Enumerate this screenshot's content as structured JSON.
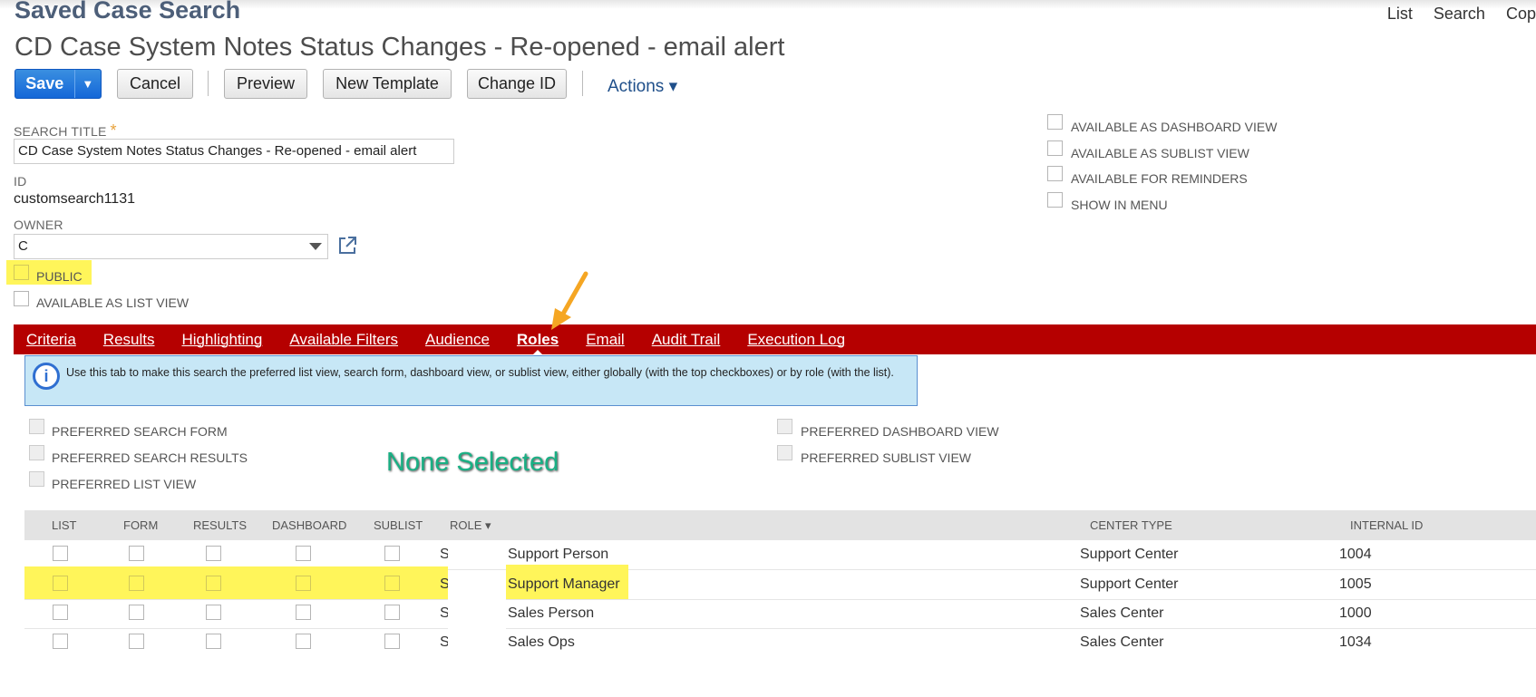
{
  "header": {
    "page_heading": "Saved Case Search",
    "top_links": [
      "List",
      "Search",
      "Cop"
    ],
    "record_title": "CD Case System Notes Status Changes - Re-opened - email alert"
  },
  "toolbar": {
    "save_label": "Save",
    "save_dropdown": "▼",
    "cancel_label": "Cancel",
    "preview_label": "Preview",
    "new_template_label": "New Template",
    "change_id_label": "Change ID",
    "actions_label": "Actions ▾"
  },
  "form": {
    "search_title_label": "SEARCH TITLE",
    "required_mark": "*",
    "search_title_value": "CD Case System Notes Status Changes - Re-opened - email alert",
    "id_label": "ID",
    "id_value": "customsearch1131",
    "owner_label": "OWNER",
    "owner_value": "C",
    "public_label": "PUBLIC",
    "available_as_list_view_label": "AVAILABLE AS LIST VIEW",
    "right_options": [
      "AVAILABLE AS DASHBOARD VIEW",
      "AVAILABLE AS SUBLIST VIEW",
      "AVAILABLE FOR REMINDERS",
      "SHOW IN MENU"
    ]
  },
  "tabs": [
    "Criteria",
    "Results",
    "Highlighting",
    "Available Filters",
    "Audience",
    "Roles",
    "Email",
    "Audit Trail",
    "Execution Log"
  ],
  "active_tab": "Roles",
  "info": {
    "icon": "info-icon",
    "text": "Use this tab to make this search the preferred list view, search form, dashboard view, or sublist view, either globally (with the top checkboxes) or by role (with the list)."
  },
  "preferences": {
    "left": [
      "PREFERRED SEARCH FORM",
      "PREFERRED SEARCH RESULTS",
      "PREFERRED LIST VIEW"
    ],
    "right": [
      "PREFERRED DASHBOARD VIEW",
      "PREFERRED SUBLIST VIEW"
    ]
  },
  "annotation": {
    "none_selected": "None Selected",
    "arrow_color": "#f5a623",
    "highlight_color": "#fff55a"
  },
  "grid": {
    "columns": [
      "LIST",
      "FORM",
      "RESULTS",
      "DASHBOARD",
      "SUBLIST",
      "ROLE ▾",
      "CENTER TYPE",
      "INTERNAL ID"
    ],
    "rows": [
      {
        "role_prefix": "S",
        "role": "Support Person",
        "center_type": "Support Center",
        "internal_id": "1004"
      },
      {
        "role_prefix": "S",
        "role": "Support Manager",
        "center_type": "Support Center",
        "internal_id": "1005"
      },
      {
        "role_prefix": "S",
        "role": "Sales Person",
        "center_type": "Sales Center",
        "internal_id": "1000"
      },
      {
        "role_prefix": "S",
        "role": "Sales Ops",
        "center_type": "Sales Center",
        "internal_id": "1034"
      }
    ]
  },
  "colors": {
    "tab_bar": "#b50000",
    "save_button": "#1467d8",
    "heading": "#4d5f79",
    "info_bg": "#c7e7f6"
  }
}
